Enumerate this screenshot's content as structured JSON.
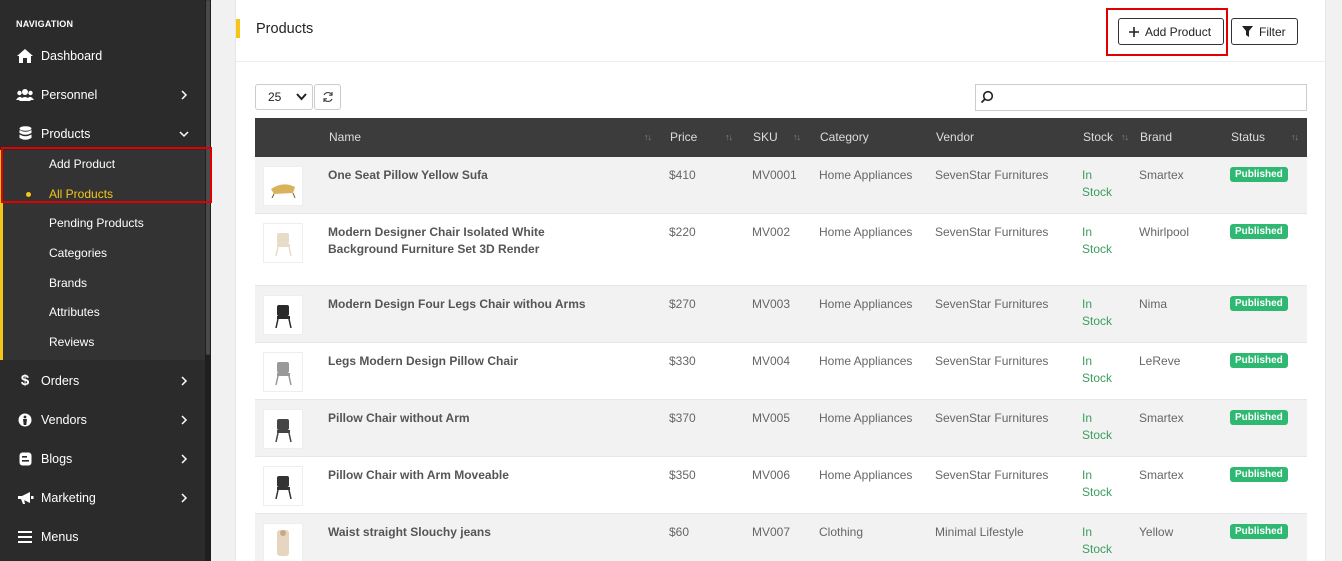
{
  "sidebar": {
    "heading": "NAVIGATION",
    "items": [
      {
        "label": "Dashboard",
        "icon": "home-icon"
      },
      {
        "label": "Personnel",
        "icon": "users-icon"
      },
      {
        "label": "Products",
        "icon": "database-icon"
      },
      {
        "label": "Orders",
        "icon": "dollar-icon"
      },
      {
        "label": "Vendors",
        "icon": "vendor-icon"
      },
      {
        "label": "Blogs",
        "icon": "blog-icon"
      },
      {
        "label": "Marketing",
        "icon": "megaphone-icon"
      },
      {
        "label": "Menus",
        "icon": "menu-icon"
      }
    ],
    "product_submenu": [
      "Add Product",
      "All Products",
      "Pending Products",
      "Categories",
      "Brands",
      "Attributes",
      "Reviews"
    ]
  },
  "header": {
    "title": "Products",
    "add_button": "Add Product",
    "filter_button": "Filter"
  },
  "controls": {
    "page_size": "25",
    "search_placeholder": ""
  },
  "table": {
    "columns": [
      "Name",
      "Price",
      "SKU",
      "Category",
      "Vendor",
      "Stock",
      "Brand",
      "Status"
    ],
    "rows": [
      {
        "name": "One Seat Pillow Yellow Sufa",
        "price": "$410",
        "sku": "MV0001",
        "category": "Home Appliances",
        "vendor": "SevenStar Furnitures",
        "stock": "In Stock",
        "brand": "Smartex",
        "status": "Published"
      },
      {
        "name": "Modern Designer Chair Isolated White Background Furniture Set 3D Render",
        "price": "$220",
        "sku": "MV002",
        "category": "Home Appliances",
        "vendor": "SevenStar Furnitures",
        "stock": "In Stock",
        "brand": "Whirlpool",
        "status": "Published"
      },
      {
        "name": "Modern Design Four Legs Chair withou Arms",
        "price": "$270",
        "sku": "MV003",
        "category": "Home Appliances",
        "vendor": "SevenStar Furnitures",
        "stock": "In Stock",
        "brand": "Nima",
        "status": "Published"
      },
      {
        "name": "Legs Modern Design Pillow Chair",
        "price": "$330",
        "sku": "MV004",
        "category": "Home Appliances",
        "vendor": "SevenStar Furnitures",
        "stock": "In Stock",
        "brand": "LeReve",
        "status": "Published"
      },
      {
        "name": "Pillow Chair without Arm",
        "price": "$370",
        "sku": "MV005",
        "category": "Home Appliances",
        "vendor": "SevenStar Furnitures",
        "stock": "In Stock",
        "brand": "Smartex",
        "status": "Published"
      },
      {
        "name": "Pillow Chair with Arm Moveable",
        "price": "$350",
        "sku": "MV006",
        "category": "Home Appliances",
        "vendor": "SevenStar Furnitures",
        "stock": "In Stock",
        "brand": "Smartex",
        "status": "Published"
      },
      {
        "name": "Waist straight Slouchy jeans",
        "price": "$60",
        "sku": "MV007",
        "category": "Clothing",
        "vendor": "Minimal Lifestyle",
        "stock": "In Stock",
        "brand": "Yellow",
        "status": "Published"
      }
    ]
  },
  "colors": {
    "accent": "#f5c518",
    "sidebar_bg": "#2b2b2b",
    "status_green": "#2eb872",
    "highlight_red": "#e00000"
  }
}
